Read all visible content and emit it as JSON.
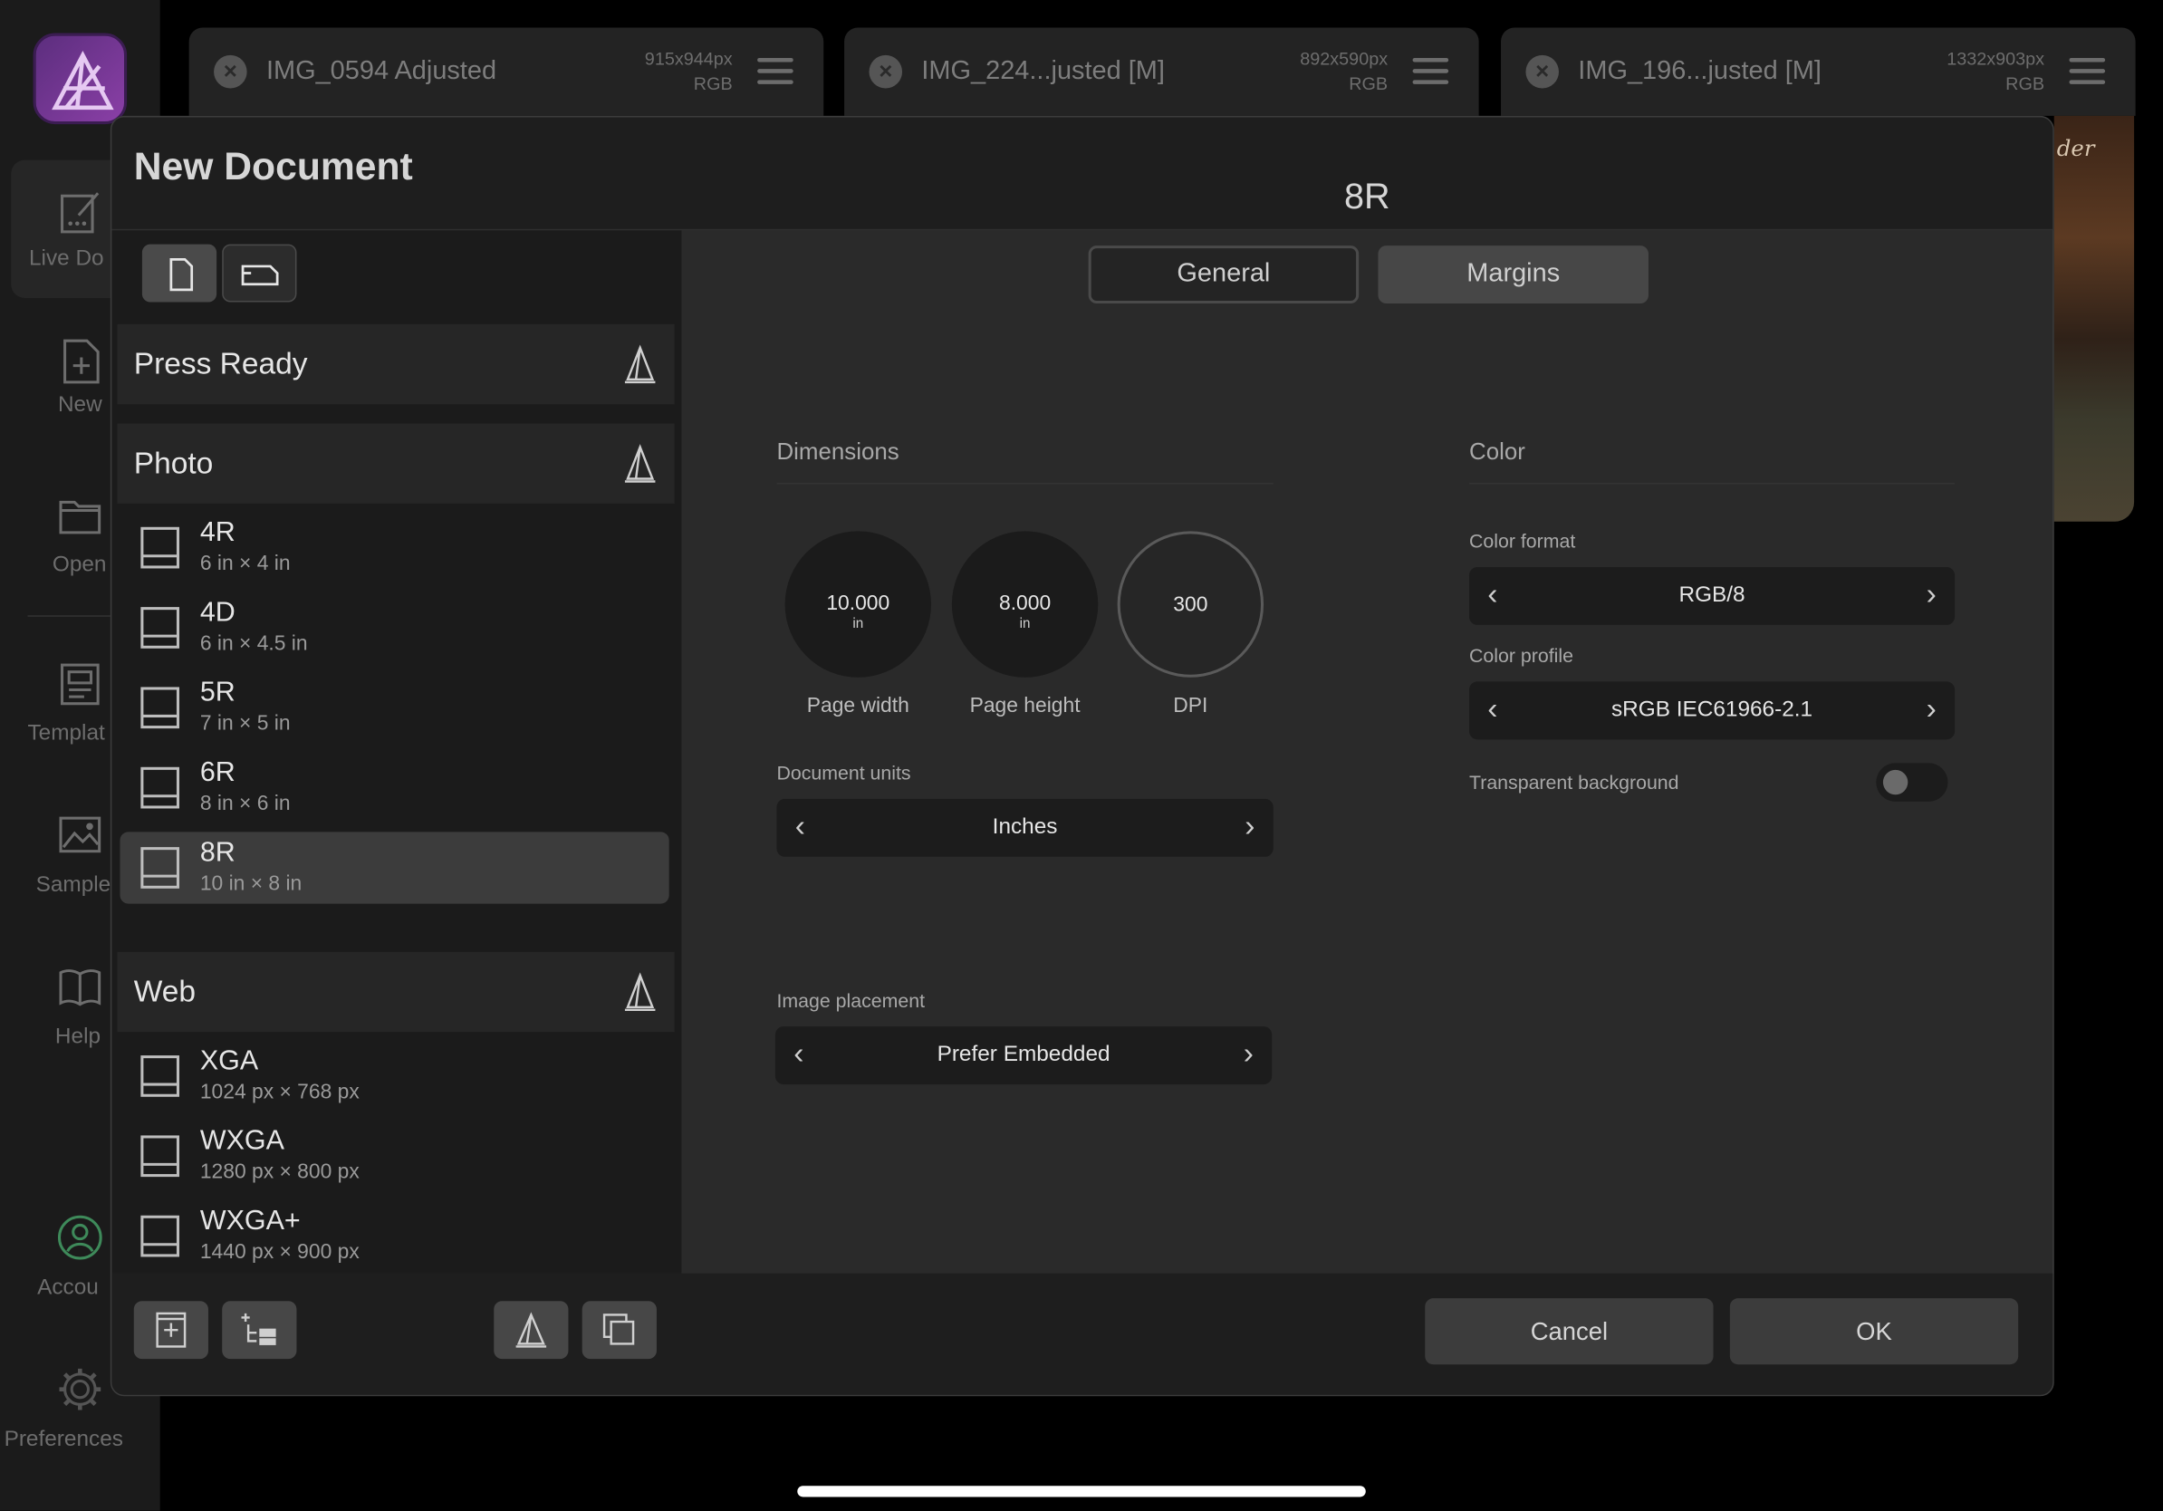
{
  "rail": {
    "items": [
      {
        "label": "Live Do",
        "icon": "live-document-icon"
      },
      {
        "label": "New",
        "icon": "new-document-icon"
      },
      {
        "label": "Open",
        "icon": "folder-icon"
      },
      {
        "label": "Templat",
        "icon": "templates-icon"
      },
      {
        "label": "Sample",
        "icon": "samples-icon"
      },
      {
        "label": "Help",
        "icon": "help-book-icon"
      },
      {
        "label": "Accou",
        "icon": "account-icon"
      },
      {
        "label": "Preferences",
        "icon": "gear-icon"
      }
    ]
  },
  "tabs": [
    {
      "name": "IMG_0594 Adjusted",
      "size": "915x944px",
      "mode": "RGB"
    },
    {
      "name": "IMG_224...justed [M]",
      "size": "892x590px",
      "mode": "RGB"
    },
    {
      "name": "IMG_196...justed [M]",
      "size": "1332x903px",
      "mode": "RGB"
    }
  ],
  "photo_caption": "der",
  "dialog": {
    "title": "New Document",
    "preset_name": "8R",
    "segments": {
      "general": "General",
      "margins": "Margins"
    },
    "categories": {
      "press_ready": "Press Ready",
      "photo": "Photo",
      "web": "Web"
    },
    "photo_presets": [
      {
        "name": "4R",
        "size": "6 in × 4 in"
      },
      {
        "name": "4D",
        "size": "6 in × 4.5 in"
      },
      {
        "name": "5R",
        "size": "7 in × 5 in"
      },
      {
        "name": "6R",
        "size": "8 in × 6 in"
      },
      {
        "name": "8R",
        "size": "10 in × 8 in"
      }
    ],
    "web_presets": [
      {
        "name": "XGA",
        "size": "1024 px × 768 px"
      },
      {
        "name": "WXGA",
        "size": "1280 px × 800 px"
      },
      {
        "name": "WXGA+",
        "size": "1440 px × 900 px"
      }
    ],
    "dimensions": {
      "heading": "Dimensions",
      "page_width": {
        "value": "10.000",
        "unit": "in",
        "label": "Page width"
      },
      "page_height": {
        "value": "8.000",
        "unit": "in",
        "label": "Page height"
      },
      "dpi": {
        "value": "300",
        "label": "DPI"
      },
      "document_units_label": "Document units",
      "document_units": "Inches",
      "image_placement_label": "Image placement",
      "image_placement": "Prefer Embedded"
    },
    "color": {
      "heading": "Color",
      "format_label": "Color format",
      "format": "RGB/8",
      "profile_label": "Color profile",
      "profile": "sRGB IEC61966-2.1",
      "transparent_label": "Transparent background",
      "transparent": false
    },
    "buttons": {
      "cancel": "Cancel",
      "ok": "OK"
    }
  }
}
